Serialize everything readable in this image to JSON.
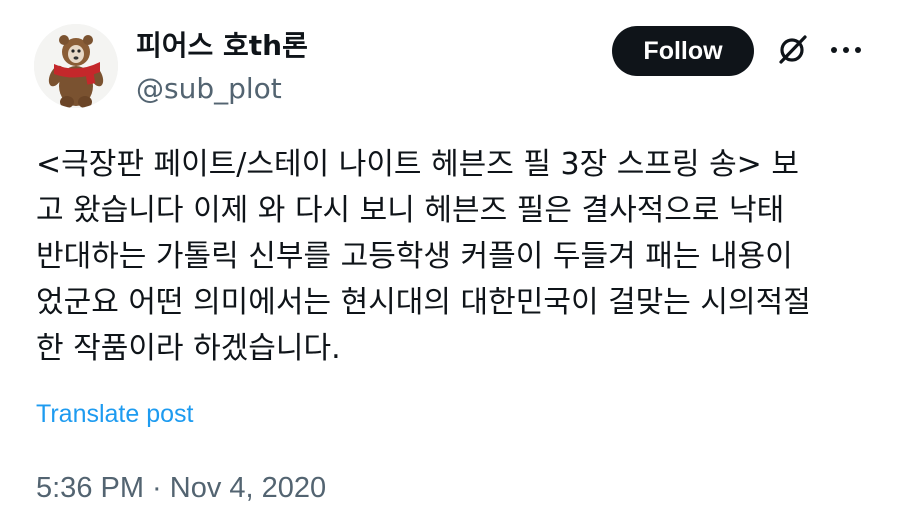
{
  "header": {
    "display_name": "피어스 호th론",
    "handle": "@sub_plot",
    "follow_label": "Follow",
    "icons": [
      "avatar",
      "grok-icon",
      "more-icon"
    ]
  },
  "post": {
    "lines": [
      "<극장판 페이트/스테이 나이트 헤븐즈 필 3장 스프링 송> 보",
      "고 왔습니다 이제 와 다시 보니 헤븐즈 필은 결사적으로 낙태",
      "반대하는 가톨릭 신부를 고등학생 커플이 두들겨 패는 내용이",
      "었군요 어떤 의미에서는 현시대의 대한민국이 걸맞는 시의적절",
      "한 작품이라 하겠습니다."
    ],
    "translate_label": "Translate post"
  },
  "meta": {
    "time": "5:36 PM",
    "separator": " · ",
    "date": "Nov 4, 2020"
  },
  "colors": {
    "text": "#0f1419",
    "secondary": "#536471",
    "link": "#1d9bf0",
    "follow_bg": "#0f1419"
  }
}
